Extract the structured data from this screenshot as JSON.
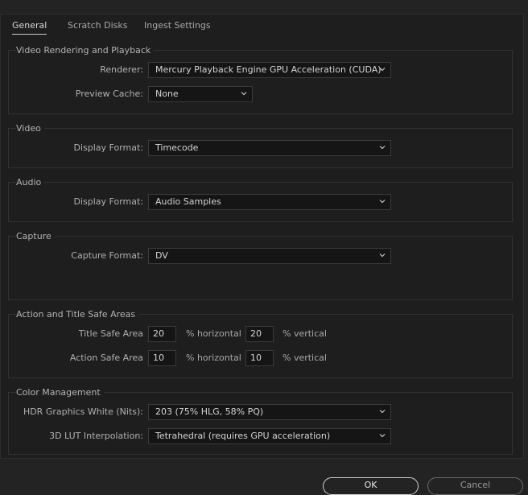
{
  "tabs": [
    {
      "label": "General"
    },
    {
      "label": "Scratch Disks"
    },
    {
      "label": "Ingest Settings"
    }
  ],
  "video_rendering": {
    "title": "Video Rendering and Playback",
    "renderer_label": "Renderer:",
    "renderer_value": "Mercury Playback Engine GPU Acceleration (CUDA)",
    "preview_cache_label": "Preview Cache:",
    "preview_cache_value": "None"
  },
  "video": {
    "title": "Video",
    "display_format_label": "Display Format:",
    "display_format_value": "Timecode"
  },
  "audio": {
    "title": "Audio",
    "display_format_label": "Display Format:",
    "display_format_value": "Audio Samples"
  },
  "capture": {
    "title": "Capture",
    "capture_format_label": "Capture Format:",
    "capture_format_value": "DV"
  },
  "safe_areas": {
    "title": "Action and Title Safe Areas",
    "title_safe_label": "Title Safe Area",
    "title_safe_h": "20",
    "title_safe_v": "20",
    "action_safe_label": "Action Safe Area",
    "action_safe_h": "10",
    "action_safe_v": "10",
    "h_unit": "% horizontal",
    "v_unit": "% vertical"
  },
  "color_management": {
    "title": "Color Management",
    "hdr_label": "HDR Graphics White (Nits):",
    "hdr_value": "203 (75% HLG, 58% PQ)",
    "lut_label": "3D LUT Interpolation:",
    "lut_value": "Tetrahedral (requires GPU acceleration)"
  },
  "buttons": {
    "ok": "OK",
    "cancel": "Cancel"
  }
}
